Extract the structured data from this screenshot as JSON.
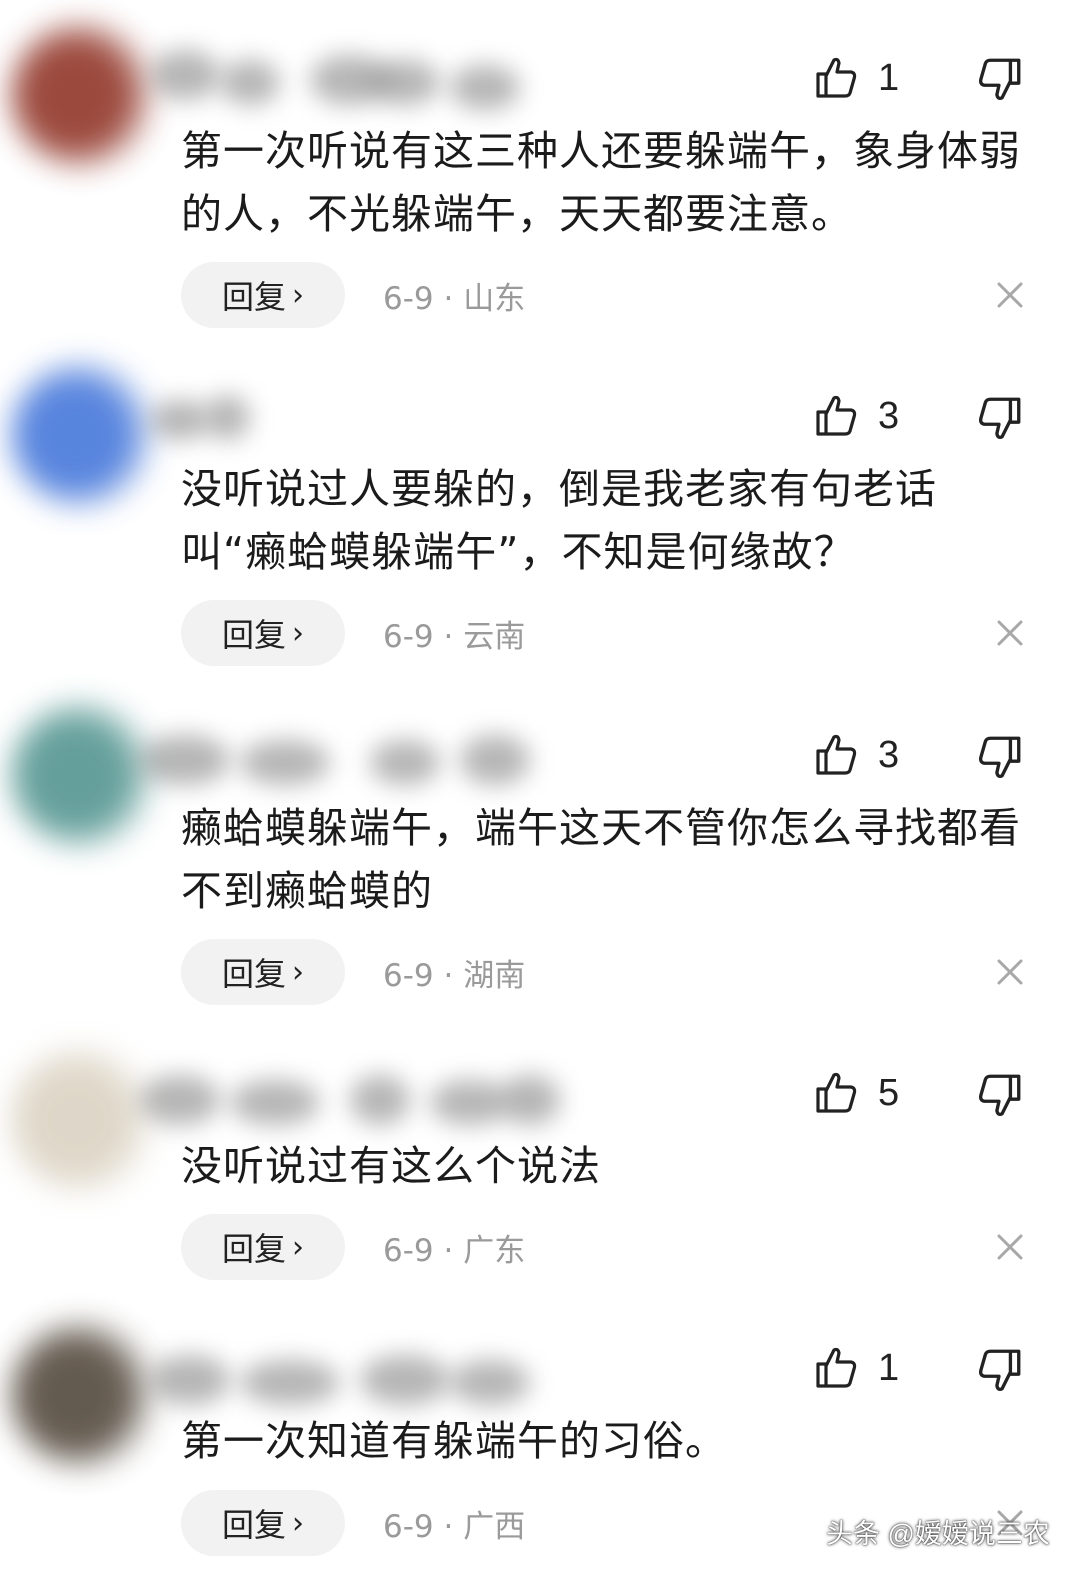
{
  "comments": [
    {
      "likes": "1",
      "text": "第一次听说有这三种人还要躲端午，象身体弱的人，不光躲端午，天天都要注意。",
      "reply_label": "回复",
      "meta": "6-9 · 山东",
      "avatar_color": "#8b2a1c"
    },
    {
      "likes": "3",
      "text": "没听说过人要躲的，倒是我老家有句老话叫“癞蛤蟆躲端午”，不知是何缘故？",
      "reply_label": "回复",
      "meta": "6-9 · 云南",
      "avatar_color": "#3a6fd8"
    },
    {
      "likes": "3",
      "text": "癞蛤蟆躲端午，端午这天不管你怎么寻找都看不到癞蛤蟆的",
      "reply_label": "回复",
      "meta": "6-9 · 湖南",
      "avatar_color": "#4a8f8a"
    },
    {
      "likes": "5",
      "text": "没听说过有这么个说法",
      "reply_label": "回复",
      "meta": "6-9 · 广东",
      "avatar_color": "#d9d0bf"
    },
    {
      "likes": "1",
      "text": "第一次知道有躲端午的习俗。",
      "reply_label": "回复",
      "meta": "6-9 · 广西",
      "avatar_color": "#4a3f32"
    }
  ],
  "icons": {
    "like": "thumbs-up-icon",
    "dislike": "thumbs-down-icon",
    "close": "close-icon",
    "chevron": "chevron-right-icon"
  },
  "watermark": "头条 @嫒嫒说三农"
}
